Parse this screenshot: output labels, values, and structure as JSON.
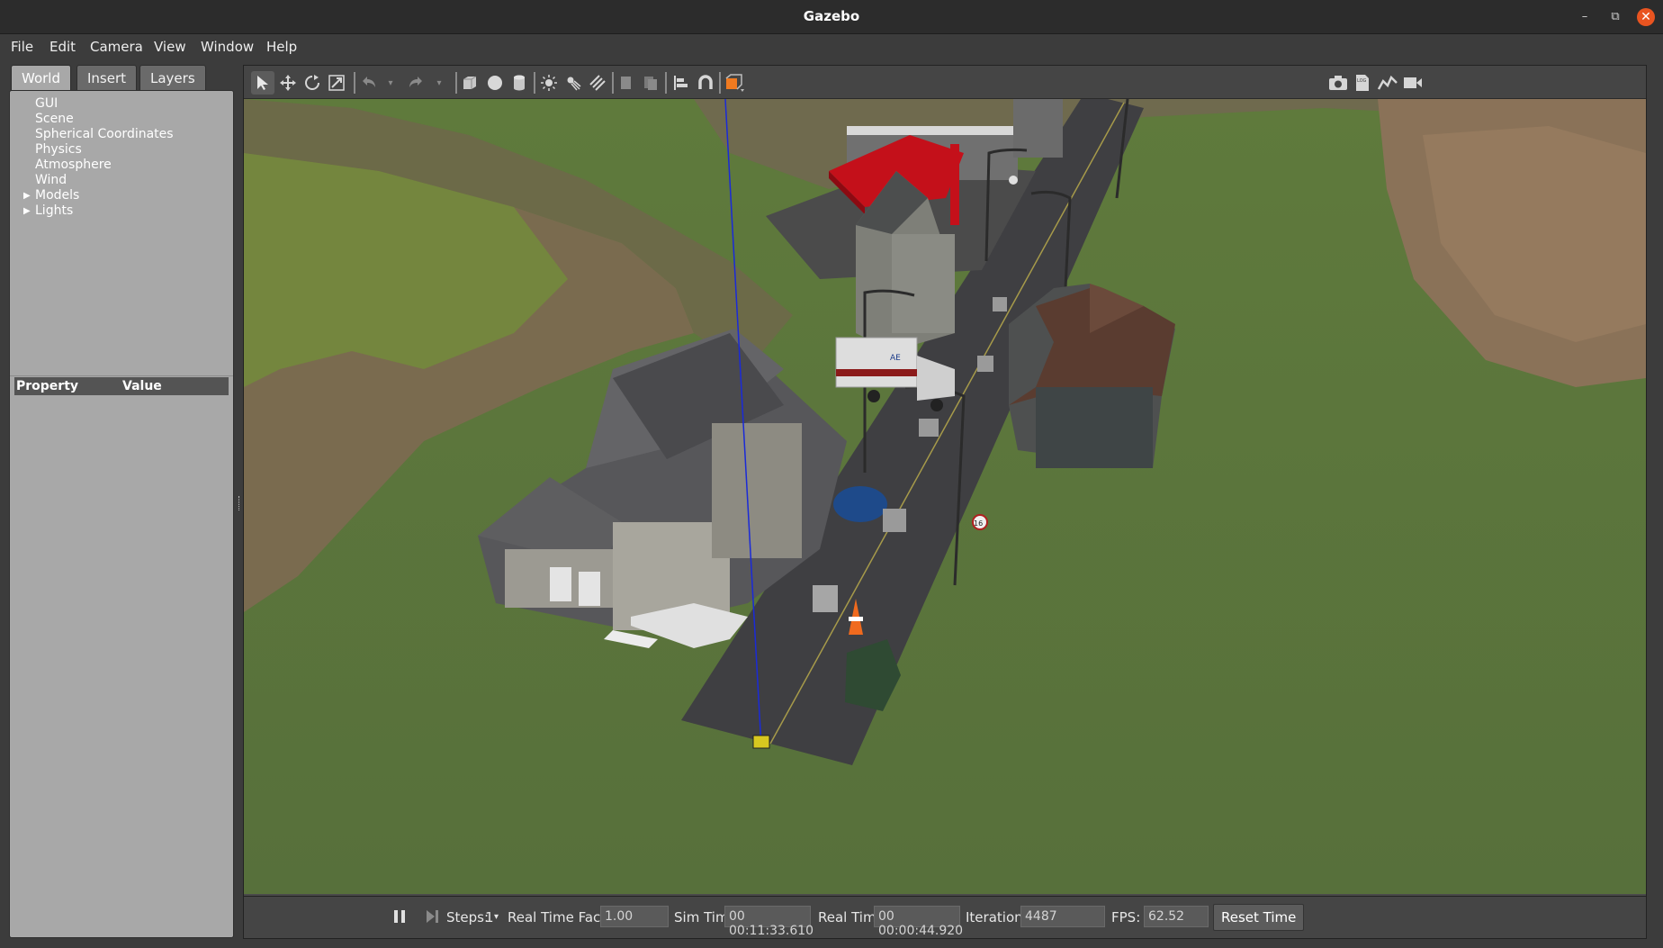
{
  "window": {
    "title": "Gazebo",
    "minimize_glyph": "–",
    "restore_glyph": "⧉",
    "close_glyph": "✕"
  },
  "menu": {
    "items": [
      "File",
      "Edit",
      "Camera",
      "View",
      "Window",
      "Help"
    ]
  },
  "left_panel": {
    "tabs": [
      "World",
      "Insert",
      "Layers"
    ],
    "active_tab": "World",
    "tree_items": [
      "GUI",
      "Scene",
      "Spherical Coordinates",
      "Physics",
      "Atmosphere",
      "Wind",
      "Models",
      "Lights"
    ],
    "expandable": [
      "Models",
      "Lights"
    ],
    "property_header": {
      "property": "Property",
      "value": "Value"
    }
  },
  "toolbar": {
    "left_tools": [
      "select-arrow-icon",
      "translate-icon",
      "rotate-icon",
      "scale-icon",
      "undo-icon",
      "undo-dropdown-icon",
      "redo-icon",
      "redo-dropdown-icon",
      "box-icon",
      "sphere-icon",
      "cylinder-icon",
      "point-light-icon",
      "spot-light-icon",
      "directional-light-icon",
      "copy-icon",
      "paste-icon",
      "align-icon",
      "snap-icon",
      "view-angle-icon"
    ],
    "right_tools": [
      "screenshot-icon",
      "log-icon",
      "plot-icon",
      "record-video-icon"
    ]
  },
  "bottom": {
    "steps_label": "Steps:",
    "steps_value": "1",
    "rtf_label": "Real Time Factor:",
    "rtf_value": "1.00",
    "sim_time_label": "Sim Time:",
    "sim_time_value": "00 00:11:33.610",
    "real_time_label": "Real Time:",
    "real_time_value": "00 00:00:44.920",
    "iterations_label": "Iterations:",
    "iterations_value": "4487",
    "fps_label": "FPS:",
    "fps_value": "62.52",
    "reset_label": "Reset Time"
  },
  "scene": {
    "sign_text": "16",
    "ambulance_mark": "AE"
  },
  "colors": {
    "close_button": "#e95420",
    "gas_station_canopy": "#c4101a",
    "selection_orange": "#f07a20"
  }
}
